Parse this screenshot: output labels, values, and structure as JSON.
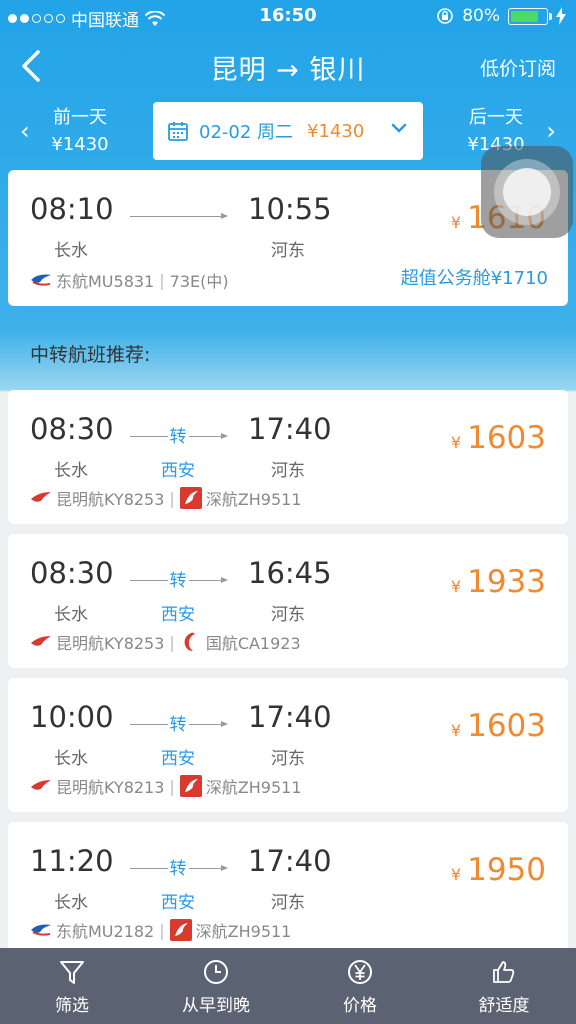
{
  "status": {
    "carrier": "中国联通",
    "time": "16:50",
    "battery": "80%"
  },
  "nav": {
    "title": "昆明 → 银川",
    "subscribe": "低价订阅"
  },
  "datebar": {
    "prev_label": "前一天",
    "prev_price": "¥1430",
    "next_label": "后一天",
    "next_price": "¥1430",
    "date": "02-02 周二",
    "price": "¥1430"
  },
  "direct_flight": {
    "dep_time": "08:10",
    "arr_time": "10:55",
    "from": "长水",
    "to": "河东",
    "price": "1610",
    "airline": "东航MU5831",
    "aircraft": "73E(中)",
    "extra": "超值公务舱¥1710"
  },
  "section_title": "中转航班推荐:",
  "transfer_flights": [
    {
      "dep_time": "08:30",
      "arr_time": "17:40",
      "from": "长水",
      "to": "河东",
      "via_mark": "转",
      "via": "西安",
      "price": "1603",
      "airline1": "昆明航KY8253",
      "airline2": "深航ZH9511"
    },
    {
      "dep_time": "08:30",
      "arr_time": "16:45",
      "from": "长水",
      "to": "河东",
      "via_mark": "转",
      "via": "西安",
      "price": "1933",
      "airline1": "昆明航KY8253",
      "airline2": "国航CA1923"
    },
    {
      "dep_time": "10:00",
      "arr_time": "17:40",
      "from": "长水",
      "to": "河东",
      "via_mark": "转",
      "via": "西安",
      "price": "1603",
      "airline1": "昆明航KY8213",
      "airline2": "深航ZH9511"
    },
    {
      "dep_time": "11:20",
      "arr_time": "17:40",
      "from": "长水",
      "to": "河东",
      "via_mark": "转",
      "via": "西安",
      "price": "1950",
      "airline1": "东航MU2182",
      "airline2": "深航ZH9511"
    }
  ],
  "currency_symbol": "¥",
  "tabbar": {
    "filter": "筛选",
    "time_sort": "从早到晚",
    "price_sort": "价格",
    "comfort": "舒适度"
  }
}
